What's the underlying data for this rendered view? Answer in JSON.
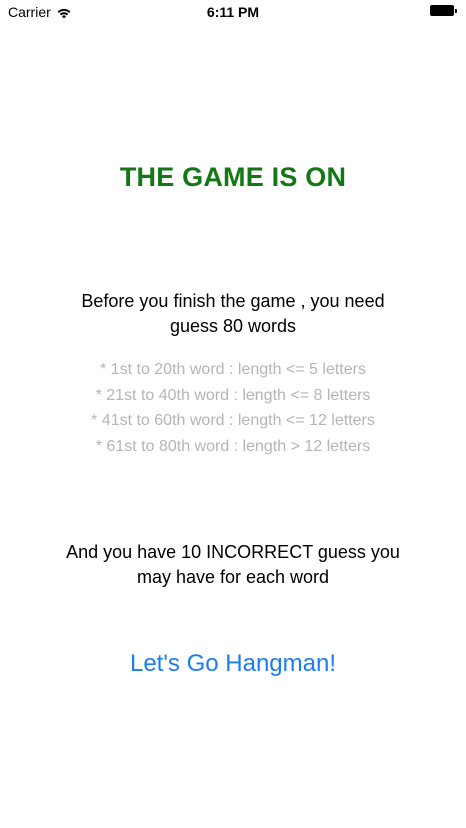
{
  "status_bar": {
    "carrier": "Carrier",
    "time": "6:11 PM",
    "wifi_icon": "wifi-icon",
    "battery_icon": "battery-icon"
  },
  "title": "THE GAME IS ON",
  "intro": {
    "line1": "Before you finish the game , you need",
    "line2": "guess 80 words"
  },
  "rules": [
    "* 1st to 20th word : length <= 5 letters",
    "* 21st to 40th word : length <= 8 letters",
    "* 41st to 60th word : length <= 12 letters",
    "* 61st to 80th word : length > 12 letters"
  ],
  "incorrect_note": {
    "line1": "And you have 10 INCORRECT guess you",
    "line2": "may have for each word"
  },
  "go_button": "Let's Go Hangman!",
  "colors": {
    "title": "#137713",
    "rules": "#b5b5b5",
    "button": "#1b7df5"
  }
}
